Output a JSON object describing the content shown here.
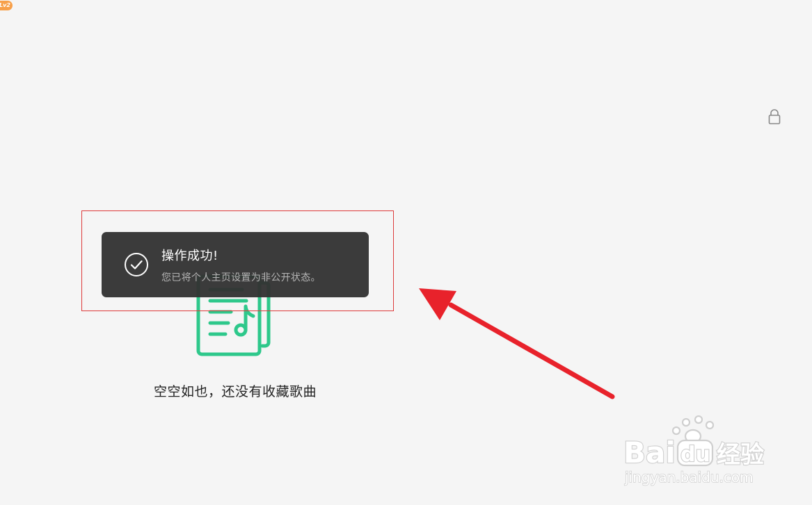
{
  "profile": {
    "level_badge": "Lv2"
  },
  "privacy": {
    "lock_icon": "lock-icon"
  },
  "empty_state": {
    "icon": "music-list-icon",
    "message": "空空如也，还没有收藏歌曲"
  },
  "toast": {
    "icon": "check-circle-icon",
    "title": "操作成功!",
    "message": "您已将个人主页设置为非公开状态。"
  },
  "watermark": {
    "brand": "Baidu经验",
    "url": "jingyan.baidu.com"
  },
  "colors": {
    "background": "#f5f5f5",
    "accent_green": "#2ec88b",
    "toast_bg": "#333333",
    "annotation_red": "#e8222b",
    "badge_orange": "#f7a04a"
  }
}
